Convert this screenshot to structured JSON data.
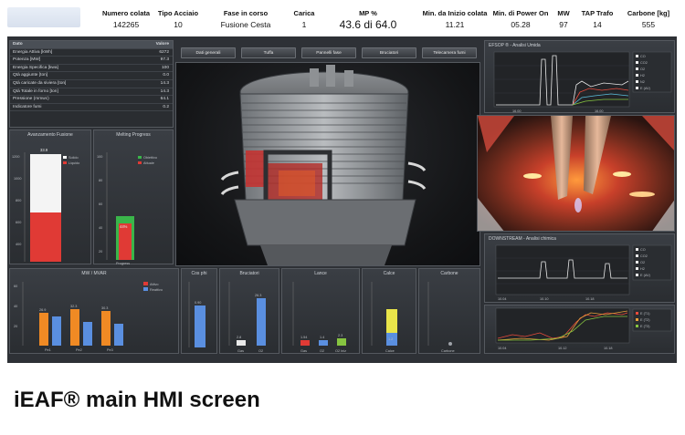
{
  "header": {
    "items": [
      {
        "label": "Numero colata",
        "value": "142265"
      },
      {
        "label": "Tipo Acciaio",
        "value": "10"
      },
      {
        "label": "Fase in corso",
        "value": "Fusione Cesta"
      },
      {
        "label": "Carica",
        "value": "1"
      },
      {
        "label": "MP %",
        "value": "43.6 di 64.0"
      },
      {
        "label": "Min. da Inizio colata",
        "value": "11.21"
      },
      {
        "label": "Min. di Power On",
        "value": "05.28"
      },
      {
        "label": "MW",
        "value": "97"
      },
      {
        "label": "TAP Trafo",
        "value": "14"
      },
      {
        "label": "Carbone [kg]",
        "value": "555"
      }
    ]
  },
  "nav": {
    "buttons": [
      "Dati generali",
      "Tuffa",
      "Pannelli fase",
      "Bruciatori",
      "Telecamera fumi"
    ]
  },
  "data_table": {
    "header_label": "Dato",
    "header_value": "Valore",
    "rows": [
      {
        "label": "Energia Attiva [kWh]",
        "value": "6272"
      },
      {
        "label": "Potenza [MW]",
        "value": "97.3"
      },
      {
        "label": "Energia Specifica [kwa]",
        "value": "100"
      },
      {
        "label": "Qtà aggiunte [ton]",
        "value": "0.0"
      },
      {
        "label": "Qtà caricate da siviera [ton]",
        "value": "14.3"
      },
      {
        "label": "Qtà Totale in forno [ton]",
        "value": "14.3"
      },
      {
        "label": "Pressione (mmwc)",
        "value": "64.1"
      },
      {
        "label": "Indicatore fumi",
        "value": "0.2"
      }
    ]
  },
  "panels": {
    "fusion": {
      "title": "Avanzamento Fusione",
      "legend": [
        "Solido",
        "Liquido"
      ],
      "value_label": "33.9"
    },
    "melting": {
      "title": "Melting Progress",
      "legend": [
        "Obiettivo",
        "Attuale"
      ],
      "value_label": "44%",
      "xlabel": "Progress"
    },
    "mw": {
      "title": "MW / MVAR",
      "legend": [
        "Attivo",
        "Reattivo"
      ],
      "values": [
        "26.9",
        "32.3",
        "30.3"
      ],
      "cats": [
        "Pe1",
        "Pe2",
        "Pe3"
      ]
    },
    "cos": {
      "title": "Cos phi",
      "value": "0.90"
    },
    "burn": {
      "title": "Bruciatori",
      "values": [
        "2.8",
        "26.3"
      ],
      "cats": [
        "Gas",
        "O2"
      ]
    },
    "lance": {
      "title": "Lance",
      "values": [
        "1.54",
        "1.4",
        "2.3"
      ],
      "cats": [
        "Gas",
        "O2",
        "O2 Iniz"
      ]
    },
    "calce": {
      "title": "Calce",
      "value": "1.2",
      "cat": "Calce"
    },
    "carbone": {
      "title": "Carbone",
      "cat": "Carbone"
    }
  },
  "right": {
    "chart1_title": "EFSOP ® - Analisi Umida",
    "chart2_title": "DOWNSTREAM - Analisi chimica",
    "legend1": [
      "CO",
      "CO2",
      "O2",
      "H2",
      "N2",
      "E (AV)"
    ],
    "legend2": [
      "CO",
      "CO2",
      "O2",
      "H2",
      "E (AV)"
    ],
    "legend3": [
      "E (T1)",
      "E (T2)",
      "E (T3)"
    ]
  },
  "caption": "iEAF® main HMI screen"
}
